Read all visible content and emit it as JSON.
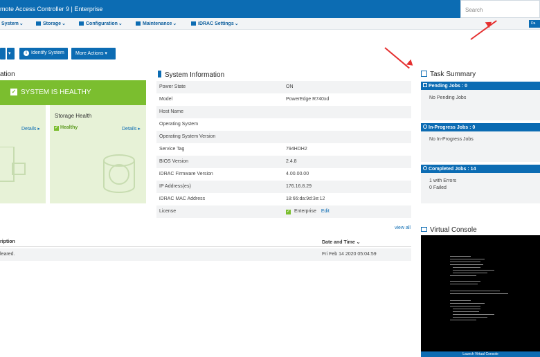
{
  "header": {
    "title": "mote Access Controller 9 | Enterprise",
    "search_placeholder": "Search",
    "dashboard_btn": "Da"
  },
  "nav": {
    "items": [
      {
        "label": "System"
      },
      {
        "label": "Storage"
      },
      {
        "label": "Configuration"
      },
      {
        "label": "Maintenance"
      },
      {
        "label": "iDRAC Settings"
      }
    ]
  },
  "toolbar": {
    "identify_label": "Identify System",
    "more_actions_label": "More Actions"
  },
  "health": {
    "section_title": "ation",
    "banner": "SYSTEM IS HEALTHY",
    "details_left": "Details",
    "storage_title": "Storage Health",
    "storage_status": "Healthy",
    "details_right": "Details"
  },
  "sysinfo": {
    "title": "System Information",
    "rows": [
      {
        "k": "Power State",
        "v": "ON"
      },
      {
        "k": "Model",
        "v": "PowerEdge R740xd"
      },
      {
        "k": "Host Name",
        "v": ""
      },
      {
        "k": "Operating System",
        "v": ""
      },
      {
        "k": "Operating System Version",
        "v": ""
      },
      {
        "k": "Service Tag",
        "v": "794HDH2"
      },
      {
        "k": "BIOS Version",
        "v": "2.4.8"
      },
      {
        "k": "iDRAC Firmware Version",
        "v": "4.00.00.00"
      },
      {
        "k": "IP Address(es)",
        "v": "176.16.8.29"
      },
      {
        "k": "iDRAC MAC Address",
        "v": "18:66:da:9d:3e:12"
      },
      {
        "k": "License",
        "v": "Enterprise"
      }
    ],
    "license_edit": "Edit"
  },
  "log": {
    "view_all": "view all",
    "col_desc": "ription",
    "col_date": "Date and Time",
    "row_desc": "leared.",
    "row_date": "Fri Feb 14 2020 05:04:59"
  },
  "tasks": {
    "title": "Task Summary",
    "pending_head": "Pending Jobs : 0",
    "pending_text": "No Pending Jobs",
    "inprogress_head": "In-Progress Jobs : 0",
    "inprogress_text": "No In-Progress Jobs",
    "completed_head": "Completed Jobs : 14",
    "completed_errors": "1  with Errors",
    "completed_failed": "0  Failed"
  },
  "console": {
    "title": "Virtual Console",
    "launch": "Launch Virtual Console"
  },
  "colors": {
    "accent": "#0c6cb3",
    "healthy": "#7bbe2f",
    "annotation_arrow": "#e53030"
  }
}
